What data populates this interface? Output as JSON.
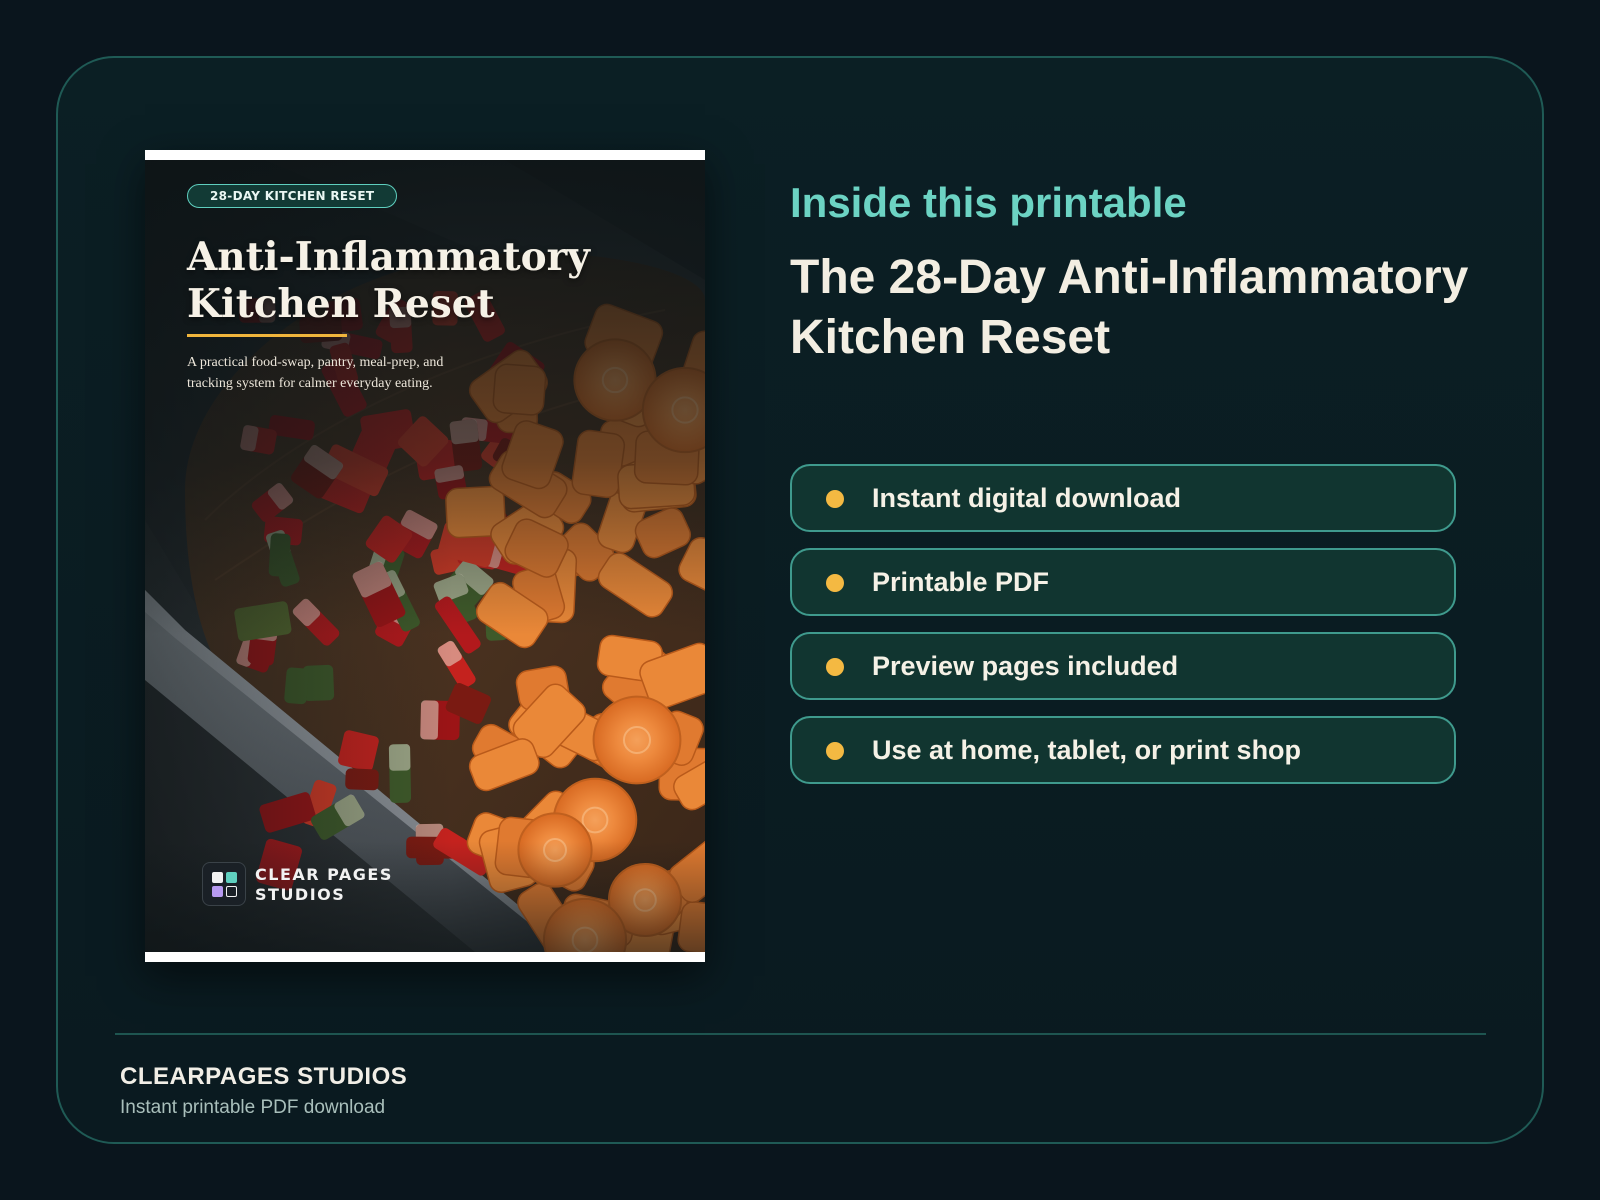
{
  "cover": {
    "badge": "28-DAY KITCHEN RESET",
    "title": "Anti-Inflammatory Kitchen Reset",
    "subtitle": "A practical food-swap, pantry, meal-prep, and tracking system for calmer everyday eating.",
    "brand": "CLEAR PAGES STUDIOS",
    "image_subject": "chopped carrots and red bell peppers on a wooden cutting board with a knife",
    "logo_icon": "four-squares-logo-icon"
  },
  "info": {
    "eyebrow": "Inside this printable",
    "heading": "The 28-Day Anti-Inflammatory Kitchen Reset"
  },
  "features": [
    {
      "label": "Instant digital download"
    },
    {
      "label": "Printable PDF"
    },
    {
      "label": "Preview pages included"
    },
    {
      "label": "Use at home, tablet, or print shop"
    }
  ],
  "footer": {
    "brand": "CLEARPAGES STUDIOS",
    "tagline": "Instant printable PDF download"
  },
  "colors": {
    "background": "#0a151d",
    "card": "#0b1f24",
    "accent_teal": "#6cd3c3",
    "accent_gold": "#f4b942",
    "feature_fill": "#113530",
    "feature_border": "#3f9a8d",
    "text_light": "#f3eee2"
  }
}
